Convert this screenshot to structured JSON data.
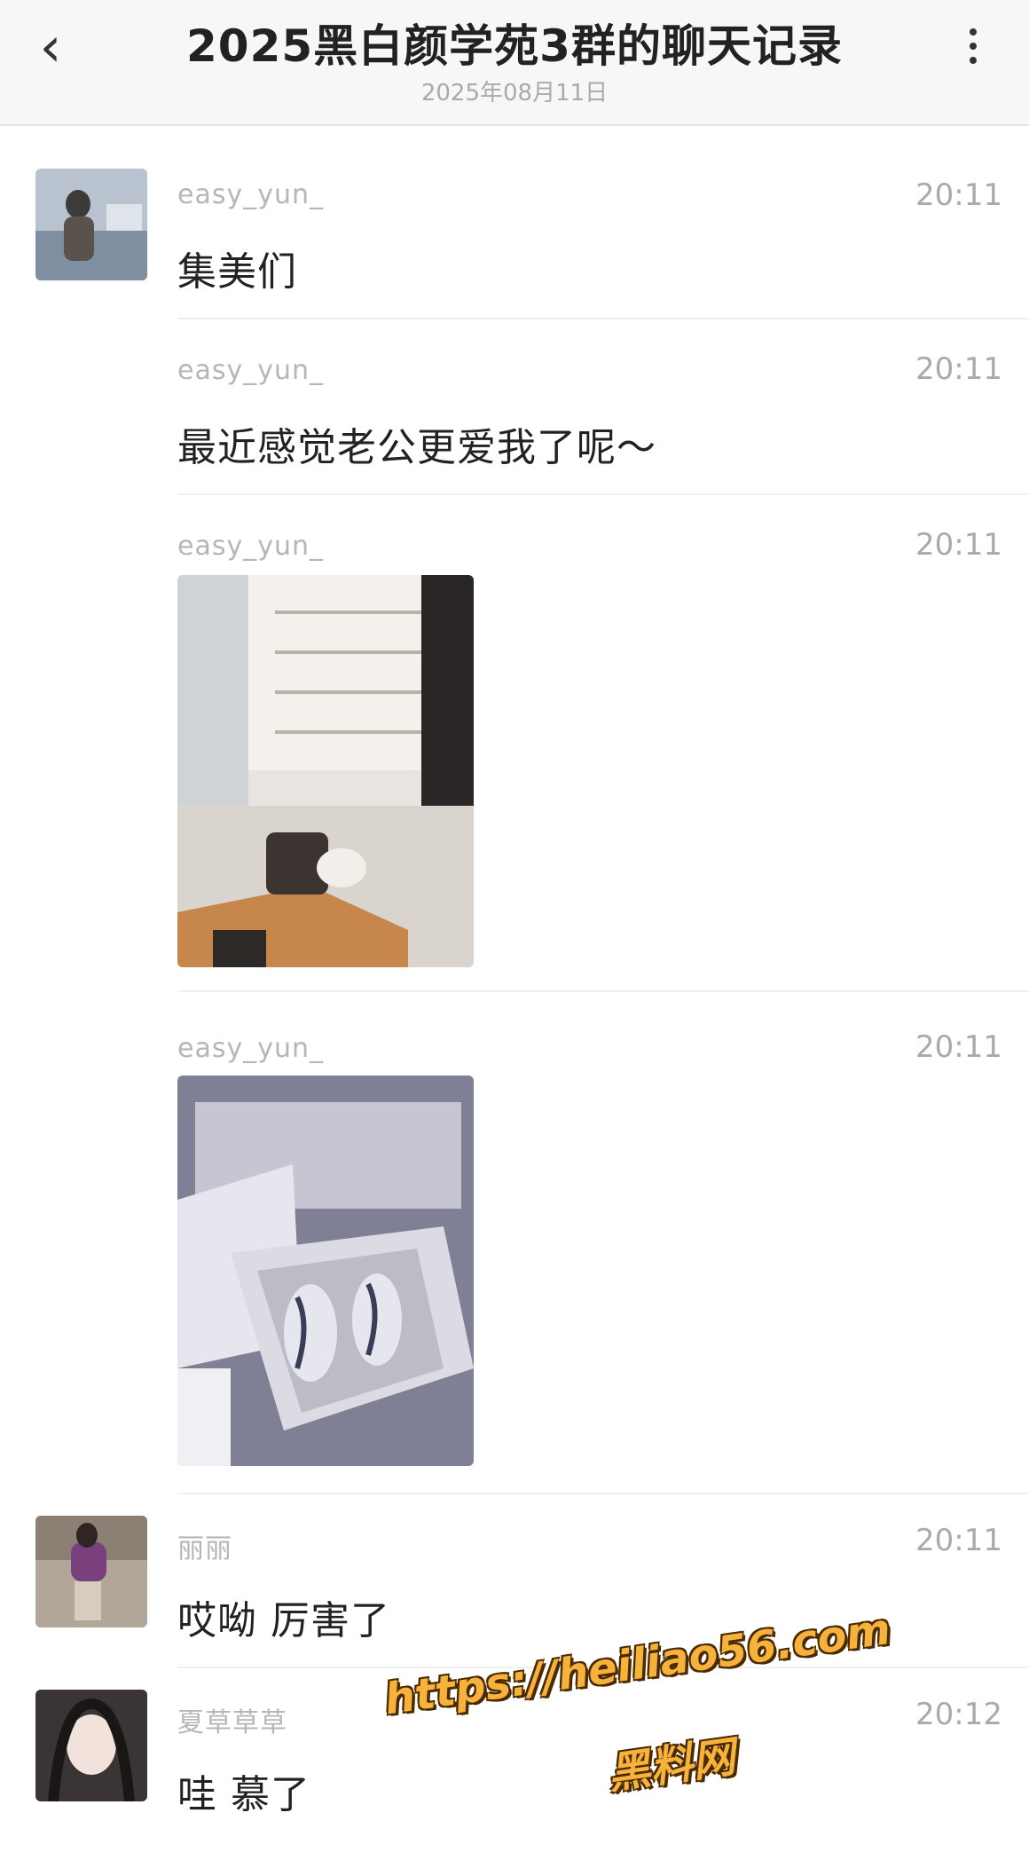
{
  "header": {
    "back_icon": "chevron-left-icon",
    "title": "2025黑白颜学苑3群的聊天记录",
    "date": "2025年08月11日",
    "more_icon": "more-vertical-icon"
  },
  "messages": [
    {
      "name": "easy_yun_",
      "time": "20:11",
      "text": "集美们",
      "avatar": true
    },
    {
      "name": "easy_yun_",
      "time": "20:11",
      "text": "最近感觉老公更爱我了呢～"
    },
    {
      "name": "easy_yun_",
      "time": "20:11",
      "image": "store-photo"
    },
    {
      "name": "easy_yun_",
      "time": "20:11",
      "image": "gift-box-photo"
    },
    {
      "name": "丽丽",
      "time": "20:11",
      "text": "哎呦 厉害了",
      "avatar": true
    },
    {
      "name": "夏草草草",
      "time": "20:12",
      "text": "哇 慕了",
      "avatar": true
    }
  ],
  "watermark": {
    "url": "https://heiliao56.com",
    "label": "黑料网",
    "color": "#f7b23b"
  }
}
